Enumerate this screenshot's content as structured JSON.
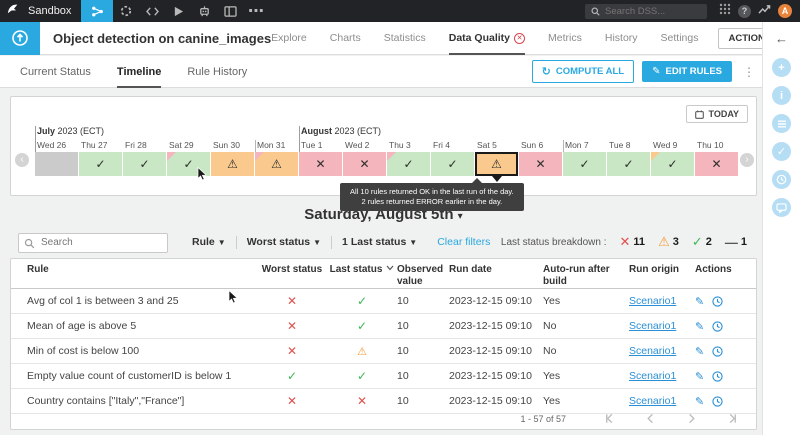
{
  "topbar": {
    "project": "Sandbox",
    "search_placeholder": "Search DSS...",
    "avatar": "A"
  },
  "header": {
    "title": "Object detection on canine_images",
    "tabs": [
      {
        "label": "Explore"
      },
      {
        "label": "Charts"
      },
      {
        "label": "Statistics"
      },
      {
        "label": "Data Quality",
        "active": true,
        "badge": "error"
      },
      {
        "label": "Metrics"
      },
      {
        "label": "History"
      },
      {
        "label": "Settings"
      }
    ],
    "actions_label": "ACTIONS"
  },
  "subtabs": {
    "items": [
      {
        "label": "Current Status"
      },
      {
        "label": "Timeline",
        "active": true
      },
      {
        "label": "Rule History"
      }
    ],
    "compute_all_label": "COMPUTE ALL",
    "edit_rules_label": "EDIT RULES"
  },
  "timeline": {
    "today_label": "TODAY",
    "days": [
      {
        "label": "Wed 26",
        "status": "empty",
        "month": "July",
        "month_suffix": "2023 (ECT)",
        "month_start": true
      },
      {
        "label": "Thu 27",
        "status": "ok"
      },
      {
        "label": "Fri 28",
        "status": "ok"
      },
      {
        "label": "Sat 29",
        "status": "ok",
        "corner": "error"
      },
      {
        "label": "Sun 30",
        "status": "warning"
      },
      {
        "label": "Mon 31",
        "status": "warning",
        "corner": "error",
        "week_start": true
      },
      {
        "label": "Tue 1",
        "status": "error",
        "month": "August",
        "month_suffix": "2023 (ECT)",
        "month_start": true
      },
      {
        "label": "Wed 2",
        "status": "error"
      },
      {
        "label": "Thu 3",
        "status": "ok",
        "corner": "error"
      },
      {
        "label": "Fri 4",
        "status": "ok"
      },
      {
        "label": "Sat 5",
        "status": "warning",
        "selected": true
      },
      {
        "label": "Sun 6",
        "status": "error"
      },
      {
        "label": "Mon 7",
        "status": "ok",
        "week_start": true
      },
      {
        "label": "Tue 8",
        "status": "ok"
      },
      {
        "label": "Wed 9",
        "status": "ok",
        "corner": "warning"
      },
      {
        "label": "Thu 10",
        "status": "error"
      }
    ],
    "tooltip": {
      "line1": "All 10 rules returned OK in the last run of the day.",
      "line2": "2 rules returned ERROR earlier in the day."
    }
  },
  "day_heading": {
    "label": "Saturday, August 5th"
  },
  "filters": {
    "search_placeholder": "Search",
    "items": [
      {
        "label": "Rule"
      },
      {
        "label": "Worst status"
      },
      {
        "count": "1",
        "label": "Last status"
      }
    ],
    "clear_label": "Clear filters"
  },
  "breakdown": {
    "label": "Last status breakdown :",
    "error": "11",
    "warning": "3",
    "ok": "2",
    "empty": "1"
  },
  "table": {
    "columns": [
      {
        "label": "Rule",
        "key": "rule"
      },
      {
        "label": "Worst status",
        "key": "worst",
        "align": "center",
        "type": "status"
      },
      {
        "label": "Last status",
        "key": "last",
        "align": "center",
        "type": "status",
        "sorted": true
      },
      {
        "label": "Observed value",
        "key": "observed"
      },
      {
        "label": "Run date",
        "key": "run_date"
      },
      {
        "label": "Auto-run after build",
        "key": "autorun"
      },
      {
        "label": "Run origin",
        "key": "origin",
        "type": "link"
      },
      {
        "label": "Actions",
        "key": "actions",
        "type": "actions"
      }
    ],
    "rows": [
      {
        "rule": "Avg of col 1 is between 3 and 25",
        "worst": "error",
        "last": "ok",
        "observed": "10",
        "run_date": "2023-12-15 09:10",
        "autorun": "Yes",
        "origin": "Scenario1"
      },
      {
        "rule": "Mean of age is above 5",
        "worst": "error",
        "last": "ok",
        "observed": "10",
        "run_date": "2023-12-15 09:10",
        "autorun": "No",
        "origin": "Scenario1"
      },
      {
        "rule": "Min of cost is below 100",
        "worst": "error",
        "last": "warning",
        "observed": "10",
        "run_date": "2023-12-15 09:10",
        "autorun": "No",
        "origin": "Scenario1"
      },
      {
        "rule": "Empty value count of customerID is below 1",
        "worst": "ok",
        "last": "ok",
        "observed": "10",
        "run_date": "2023-12-15 09:10",
        "autorun": "Yes",
        "origin": "Scenario1"
      },
      {
        "rule": "Country contains [\"Italy\",\"France\"]",
        "worst": "error",
        "last": "error",
        "observed": "10",
        "run_date": "2023-12-15 09:10",
        "autorun": "Yes",
        "origin": "Scenario1"
      }
    ]
  },
  "pagination": {
    "label": "1 - 57 of 57"
  },
  "right_rail": {
    "items": [
      "add",
      "info",
      "details",
      "checklist",
      "activity",
      "discussions"
    ]
  },
  "icons": {
    "ok": "✓",
    "error": "✕",
    "warning": "⚠",
    "empty": "—"
  },
  "colors": {
    "accent": "#29a9e0",
    "ok": "#3eb655",
    "error": "#e0524e",
    "warning": "#f39c38",
    "cell_ok": "#c9e7c4",
    "cell_error": "#f4b6bc",
    "cell_warning": "#f9c98e",
    "cell_empty": "#cbcbcb"
  }
}
